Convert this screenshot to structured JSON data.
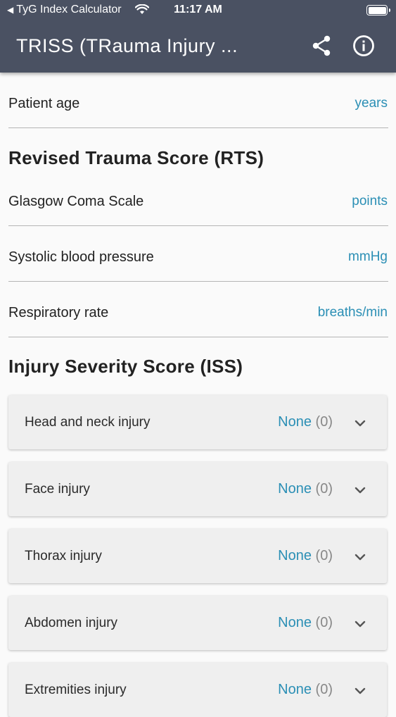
{
  "status": {
    "back_app": "TyG Index Calculator",
    "time": "11:17 AM"
  },
  "header": {
    "title": "TRISS (TRauma Injury ...",
    "share_icon": "share-icon",
    "info_icon": "info-icon"
  },
  "fields": {
    "age": {
      "label": "Patient age",
      "unit": "years"
    }
  },
  "rts": {
    "title": "Revised Trauma Score (RTS)",
    "fields": [
      {
        "label": "Glasgow Coma Scale",
        "unit": "points"
      },
      {
        "label": "Systolic blood pressure",
        "unit": "mmHg"
      },
      {
        "label": "Respiratory rate",
        "unit": "breaths/min"
      }
    ]
  },
  "iss": {
    "title": "Injury Severity Score (ISS)",
    "items": [
      {
        "label": "Head and neck injury",
        "value": "None",
        "score": "(0)"
      },
      {
        "label": "Face injury",
        "value": "None",
        "score": "(0)"
      },
      {
        "label": "Thorax injury",
        "value": "None",
        "score": "(0)"
      },
      {
        "label": "Abdomen injury",
        "value": "None",
        "score": "(0)"
      },
      {
        "label": "Extremities injury",
        "value": "None",
        "score": "(0)"
      }
    ]
  },
  "colors": {
    "header_bg": "#4a5162",
    "accent": "#2b8fb5"
  }
}
